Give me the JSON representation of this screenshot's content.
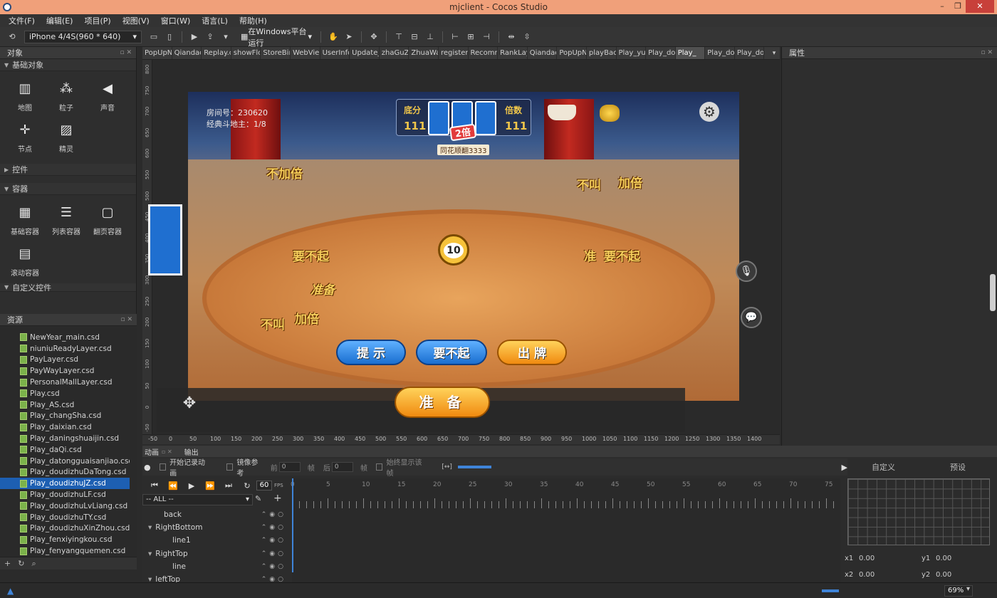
{
  "window": {
    "title": "mjclient - Cocos Studio",
    "min": "–",
    "max": "❐",
    "close": "✕"
  },
  "menu": [
    "文件(F)",
    "编辑(E)",
    "项目(P)",
    "视图(V)",
    "窗口(W)",
    "语言(L)",
    "帮助(H)"
  ],
  "toolbar": {
    "device": "iPhone 4/4S(960 * 640)",
    "run_target": "在Windows平台运行"
  },
  "objects_panel": {
    "title": "对象",
    "basic_title": "基础对象",
    "basic": [
      "地图",
      "粒子",
      "声音",
      "节点",
      "精灵"
    ],
    "controls_title": "控件",
    "containers_title": "容器",
    "containers": [
      "基础容器",
      "列表容器",
      "翻页容器",
      "滚动容器"
    ],
    "custom_title": "自定义控件"
  },
  "resources": {
    "title": "资源",
    "files": [
      "NewYear_main.csd",
      "niuniuReadyLayer.csd",
      "PayLayer.csd",
      "PayWayLayer.csd",
      "PersonalMallLayer.csd",
      "Play.csd",
      "Play_AS.csd",
      "Play_changSha.csd",
      "Play_daixian.csd",
      "Play_daningshuaijin.csd",
      "Play_daQi.csd",
      "Play_datongguaisanjiao.csd",
      "Play_doudizhuDaTong.csd",
      "Play_doudizhuJZ.csd",
      "Play_doudizhuLF.csd",
      "Play_doudizhuLvLiang.csd",
      "Play_doudizhuTY.csd",
      "Play_doudizhuXinZhou.csd",
      "Play_fenxiyingkou.csd",
      "Play_fenyangquemen.csd"
    ],
    "active": "Play_doudizhuJZ.csd"
  },
  "tabs": [
    "PopUpN",
    "Qiandao",
    "Replay.c",
    "showFlo",
    "StoreBir",
    "WebVie",
    "UserInfo",
    "Update_",
    "zhaGuZ",
    "ZhuaWa",
    "register",
    "Recomm",
    "RankLay",
    "Qiandao",
    "PopUpN",
    "playBac",
    "Play_yu",
    "Play_do",
    "Play_",
    "Play_do",
    "Play_do"
  ],
  "active_tab_index": 18,
  "canvas": {
    "vruler": [
      "800",
      "750",
      "700",
      "650",
      "600",
      "550",
      "500",
      "450",
      "400",
      "350",
      "300",
      "250",
      "200",
      "150",
      "100",
      "50",
      "0",
      "-50"
    ],
    "hruler": [
      "-50",
      "0",
      "50",
      "100",
      "150",
      "200",
      "250",
      "300",
      "350",
      "400",
      "450",
      "500",
      "550",
      "600",
      "650",
      "700",
      "750",
      "800",
      "850",
      "900",
      "950",
      "1000",
      "1050",
      "1100",
      "1150",
      "1200",
      "1250",
      "1300",
      "1350",
      "1400"
    ],
    "room": "房间号：230620",
    "mode": "经典斗地主：1/8",
    "base_label": "底分",
    "base_value": "111",
    "mult_label": "倍数",
    "mult_value": "111",
    "badge": "2倍",
    "combo": "同花顺翻3333",
    "clock": "10",
    "texts": {
      "t1": "不加倍",
      "t2": "不叫",
      "t3": "加倍",
      "t4": "要不起",
      "t5": "准备",
      "t6": "要不起",
      "t7": "不叫",
      "t8": "加倍",
      "t9": "准"
    },
    "buttons": {
      "hint": "提 示",
      "pass": "要不起",
      "play": "出 牌",
      "ready": "准 备"
    }
  },
  "properties": {
    "title": "属性"
  },
  "bottom": {
    "tabs": [
      "动画",
      "输出"
    ],
    "record": "开始记录动画",
    "mirror": "镜像参考",
    "before": "前",
    "before_val": "0",
    "frame1": "帧",
    "after": "后",
    "after_val": "0",
    "frame2": "帧",
    "always": "始终显示该帧",
    "fps": "60",
    "fps_unit": "FPS",
    "filter": "-- ALL --",
    "tree": [
      {
        "name": "back",
        "depth": 1,
        "open": false
      },
      {
        "name": "RightBottom",
        "depth": 1,
        "open": true
      },
      {
        "name": "line1",
        "depth": 2,
        "open": false
      },
      {
        "name": "RightTop",
        "depth": 1,
        "open": true
      },
      {
        "name": "line",
        "depth": 2,
        "open": false
      },
      {
        "name": "leftTop",
        "depth": 1,
        "open": true
      }
    ],
    "timeline_marks": [
      "0",
      "5",
      "10",
      "15",
      "20",
      "25",
      "30",
      "35",
      "40",
      "45",
      "50",
      "55",
      "60",
      "65",
      "70",
      "75"
    ],
    "curve_tabs": [
      "自定义",
      "预设"
    ],
    "x1_label": "x1",
    "x1": "0.00",
    "y1_label": "y1",
    "y1": "0.00",
    "x2_label": "x2",
    "x2": "0.00",
    "y2_label": "y2",
    "y2": "0.00"
  },
  "status": {
    "zoom": "69%"
  }
}
